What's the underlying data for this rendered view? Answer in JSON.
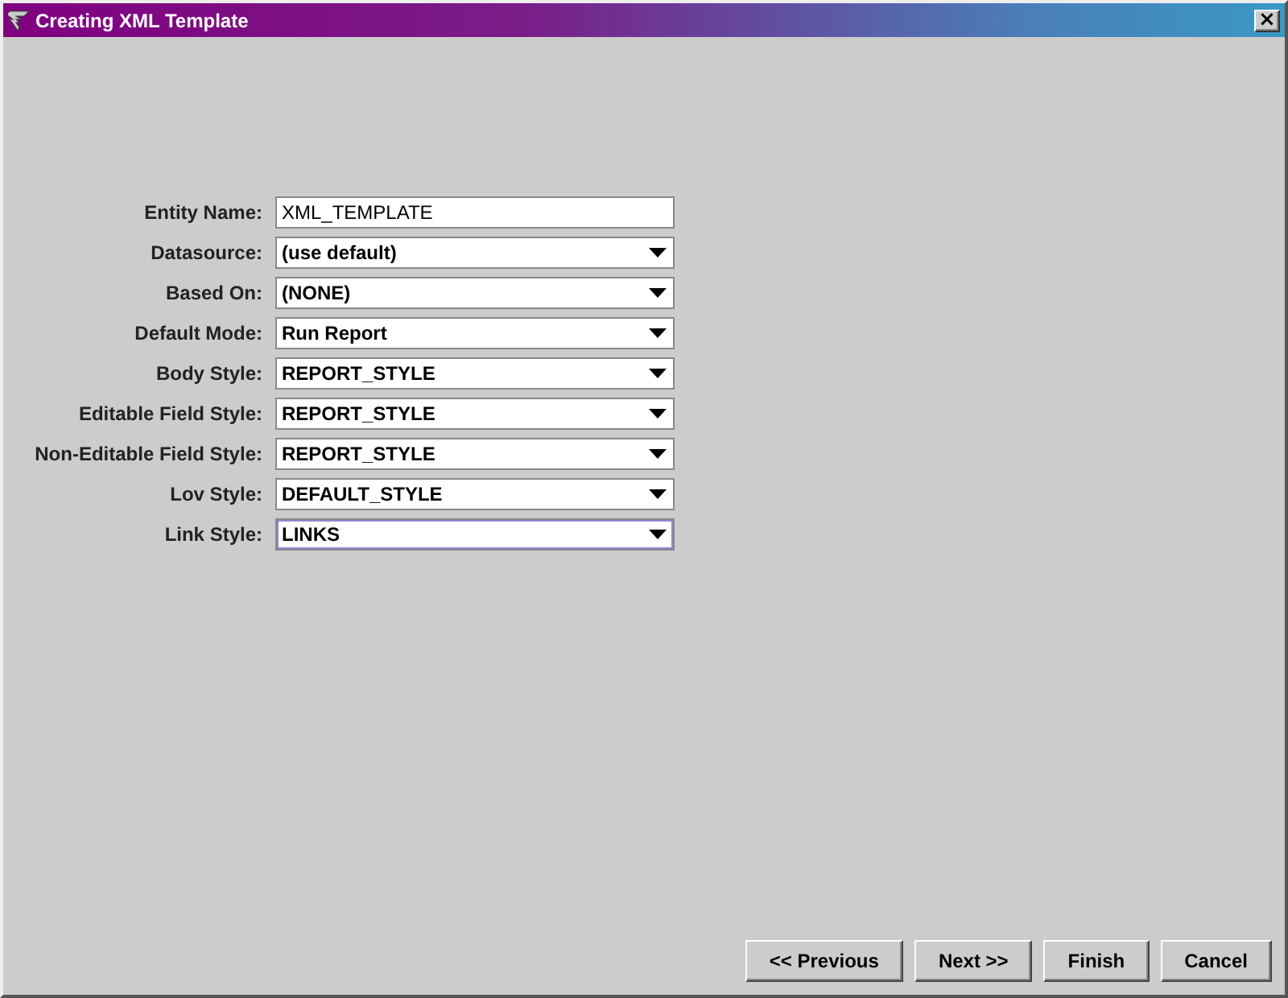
{
  "window": {
    "title": "Creating XML Template",
    "close_label": "×"
  },
  "fields": [
    {
      "label": "Entity Name:",
      "kind": "text",
      "value": "XML_TEMPLATE",
      "focused": false
    },
    {
      "label": "Datasource:",
      "kind": "combo",
      "value": "(use default)",
      "focused": false
    },
    {
      "label": "Based On:",
      "kind": "combo",
      "value": "(NONE)",
      "focused": false
    },
    {
      "label": "Default Mode:",
      "kind": "combo",
      "value": "Run Report",
      "focused": false
    },
    {
      "label": "Body Style:",
      "kind": "combo",
      "value": "REPORT_STYLE",
      "focused": false
    },
    {
      "label": "Editable Field Style:",
      "kind": "combo",
      "value": "REPORT_STYLE",
      "focused": false
    },
    {
      "label": "Non-Editable Field Style:",
      "kind": "combo",
      "value": "REPORT_STYLE",
      "focused": false
    },
    {
      "label": "Lov Style:",
      "kind": "combo",
      "value": "DEFAULT_STYLE",
      "focused": false
    },
    {
      "label": "Link Style:",
      "kind": "combo",
      "value": "LINKS",
      "focused": true
    }
  ],
  "buttons": [
    "<< Previous",
    "Next >>",
    "Finish",
    "Cancel"
  ]
}
